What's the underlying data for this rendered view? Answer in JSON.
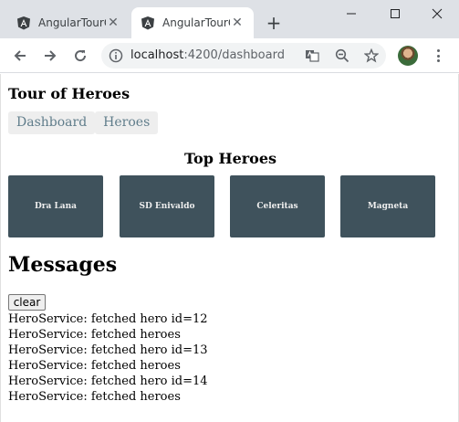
{
  "browser": {
    "tabs": [
      {
        "title": "AngularTourOfHeroes",
        "active": false
      },
      {
        "title": "AngularTourOfHeroes",
        "active": true
      }
    ],
    "new_tab_label": "+",
    "url_host": "localhost",
    "url_rest": ":4200/dashboard"
  },
  "app": {
    "title": "Tour of Heroes",
    "nav": [
      "Dashboard",
      "Heroes"
    ]
  },
  "dashboard": {
    "title": "Top Heroes",
    "heroes": [
      "Dra Lana",
      "SD Enivaldo",
      "Celeritas",
      "Magneta"
    ]
  },
  "messages": {
    "title": "Messages",
    "clear_label": "clear",
    "items": [
      "HeroService: fetched hero id=12",
      "HeroService: fetched heroes",
      "HeroService: fetched hero id=13",
      "HeroService: fetched heroes",
      "HeroService: fetched hero id=14",
      "HeroService: fetched heroes"
    ]
  },
  "colors": {
    "hero_card": "#3f525c",
    "nav_text": "#607d8b",
    "chrome_bg": "#dee1e6"
  }
}
